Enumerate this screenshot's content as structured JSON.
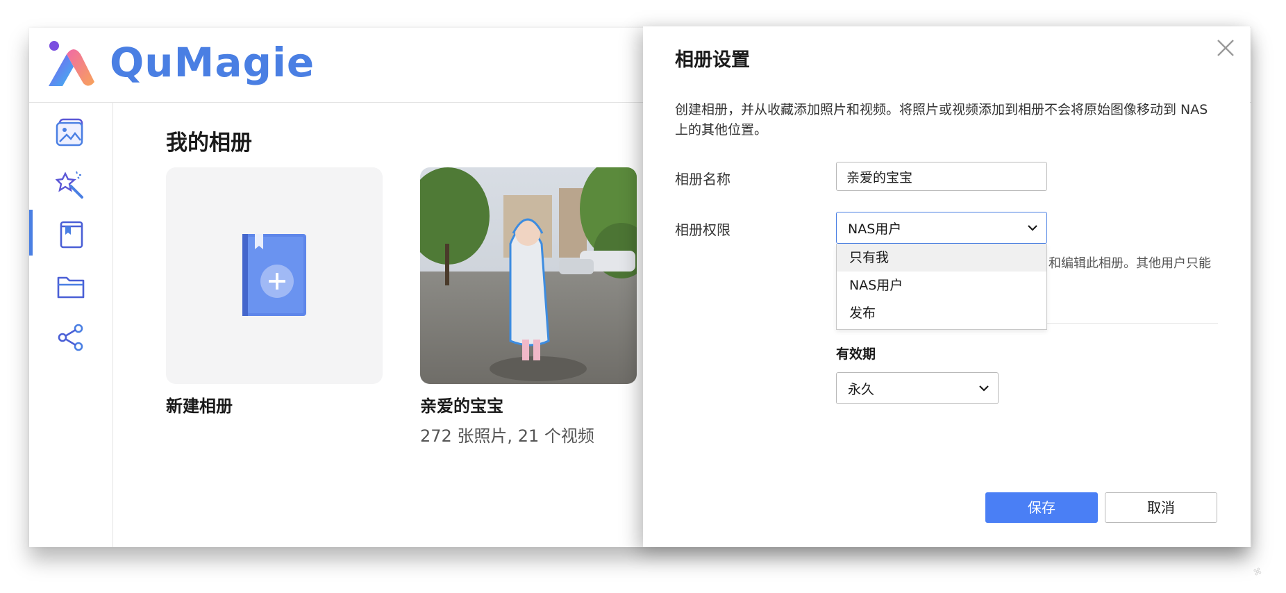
{
  "app": {
    "brand": "QuMagie",
    "brand_color": "#4a7fe3",
    "sidebar": {
      "items": [
        {
          "name": "photos",
          "icon": "photos-icon"
        },
        {
          "name": "smart",
          "icon": "magic-wand-icon"
        },
        {
          "name": "albums",
          "icon": "album-icon",
          "active": true
        },
        {
          "name": "folders",
          "icon": "folder-icon"
        },
        {
          "name": "share",
          "icon": "share-icon"
        }
      ]
    },
    "main": {
      "title": "我的相册",
      "albums": [
        {
          "name": "新建相册",
          "meta": "",
          "type": "new"
        },
        {
          "name": "亲爱的宝宝",
          "meta": "272 张照片, 21 个视频",
          "type": "photo"
        }
      ]
    }
  },
  "dialog": {
    "title": "相册设置",
    "description": "创建相册，并从收藏添加照片和视频。将照片或视频添加到相册不会将原始图像移动到 NAS 上的其他位置。",
    "name_label": "相册名称",
    "name_value": "亲爱的宝宝",
    "permission_label": "相册权限",
    "permission_value": "NAS用户",
    "permission_options": [
      "只有我",
      "NAS用户",
      "发布"
    ],
    "permission_hint": "和编辑此相册。其他用户只能",
    "validity_label": "有效期",
    "validity_value": "永久",
    "save_label": "保存",
    "cancel_label": "取消",
    "accent_color": "#4a7ff5"
  }
}
